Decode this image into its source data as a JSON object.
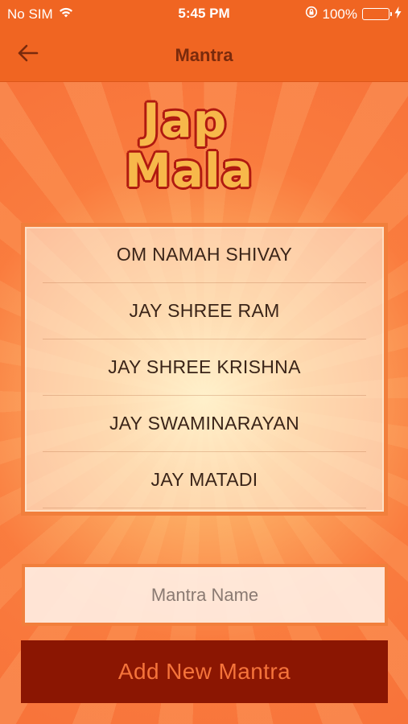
{
  "status_bar": {
    "carrier": "No SIM",
    "time": "5:45 PM",
    "battery_percent": "100%",
    "battery_level": 1.0,
    "battery_color": "#76e354"
  },
  "nav": {
    "title": "Mantra",
    "back_icon": "arrow-left-icon"
  },
  "logo": {
    "line1": "Jap",
    "line2": "Mala"
  },
  "mantras": [
    "OM NAMAH SHIVAY",
    "JAY SHREE RAM",
    "JAY SHREE KRISHNA",
    "JAY SWAMINARAYAN",
    "JAY MATADI"
  ],
  "form": {
    "mantra_name_placeholder": "Mantra Name",
    "mantra_name_value": "",
    "add_button_label": "Add New Mantra"
  },
  "colors": {
    "nav_bar": "#f06522",
    "nav_title": "#7a2a0c",
    "add_button_bg": "#8b1602",
    "add_button_text": "#f5743b",
    "list_border": "#f17f3c"
  }
}
